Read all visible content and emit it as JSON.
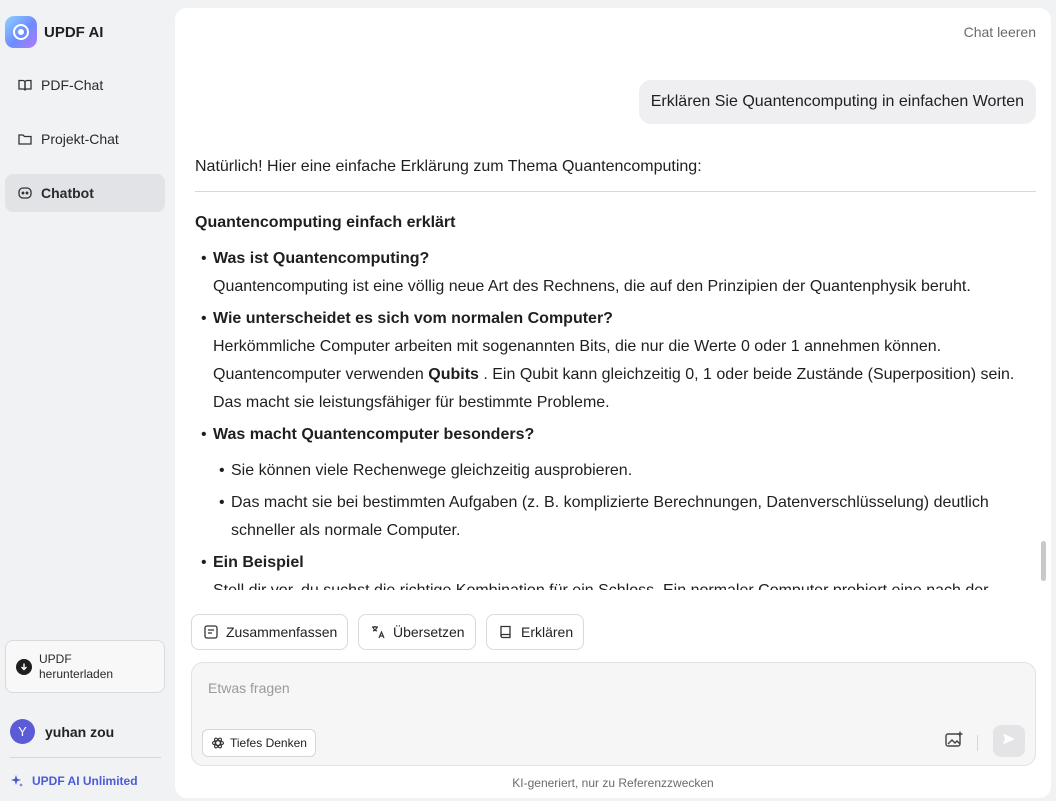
{
  "sidebar": {
    "brand": "UPDF AI",
    "items": [
      {
        "label": "PDF-Chat",
        "icon": "book-open-icon"
      },
      {
        "label": "Projekt-Chat",
        "icon": "folder-icon"
      },
      {
        "label": "Chatbot",
        "icon": "chatbot-icon",
        "active": true
      }
    ],
    "download_line1": "UPDF",
    "download_line2": "herunterladen",
    "user_initial": "Y",
    "user_name": "yuhan zou",
    "unlimited": "UPDF AI Unlimited"
  },
  "header": {
    "clear_chat": "Chat leeren"
  },
  "chat": {
    "user_message": "Erklären Sie Quantencomputing in einfachen Worten",
    "answer": {
      "intro": "Natürlich! Hier eine einfache Erklärung zum Thema Quantencomputing:",
      "heading": "Quantencomputing einfach erklärt",
      "s1_title": "Was ist Quantencomputing?",
      "s1_line1": "Quantencomputing ist eine völlig neue Art des Rechnens, die auf den Prinzipien der Quantenphysik beruht.",
      "s2_title": "Wie unterscheidet es sich vom normalen Computer?",
      "s2_line1": "Herkömmliche Computer arbeiten mit sogenannten Bits, die nur die Werte 0 oder 1 annehmen können.",
      "s2_line2_a": "Quantencomputer verwenden ",
      "s2_line2_b": "Qubits",
      "s2_line2_c": " . Ein Qubit kann gleichzeitig 0, 1 oder beide Zustände (Superposition) sein.",
      "s2_line3": "Das macht sie leistungsfähiger für bestimmte Probleme.",
      "s3_title": "Was macht Quantencomputer besonders?",
      "s3_sub1": "Sie können viele Rechenwege gleichzeitig ausprobieren.",
      "s3_sub2": "Das macht sie bei bestimmten Aufgaben (z. B. komplizierte Berechnungen, Datenverschlüsselung) deutlich",
      "s3_sub2b": "schneller als normale Computer.",
      "s4_title": "Ein Beispiel",
      "s4_line1": "Stell dir vor, du suchst die richtige Kombination für ein Schloss. Ein normaler Computer probiert eine nach der"
    }
  },
  "actions": {
    "summarize": "Zusammenfassen",
    "translate": "Übersetzen",
    "explain": "Erklären"
  },
  "input": {
    "placeholder": "Etwas fragen",
    "deep_think": "Tiefes Denken"
  },
  "footer": {
    "disclaimer": "KI-generiert, nur zu Referenzzwecken"
  }
}
